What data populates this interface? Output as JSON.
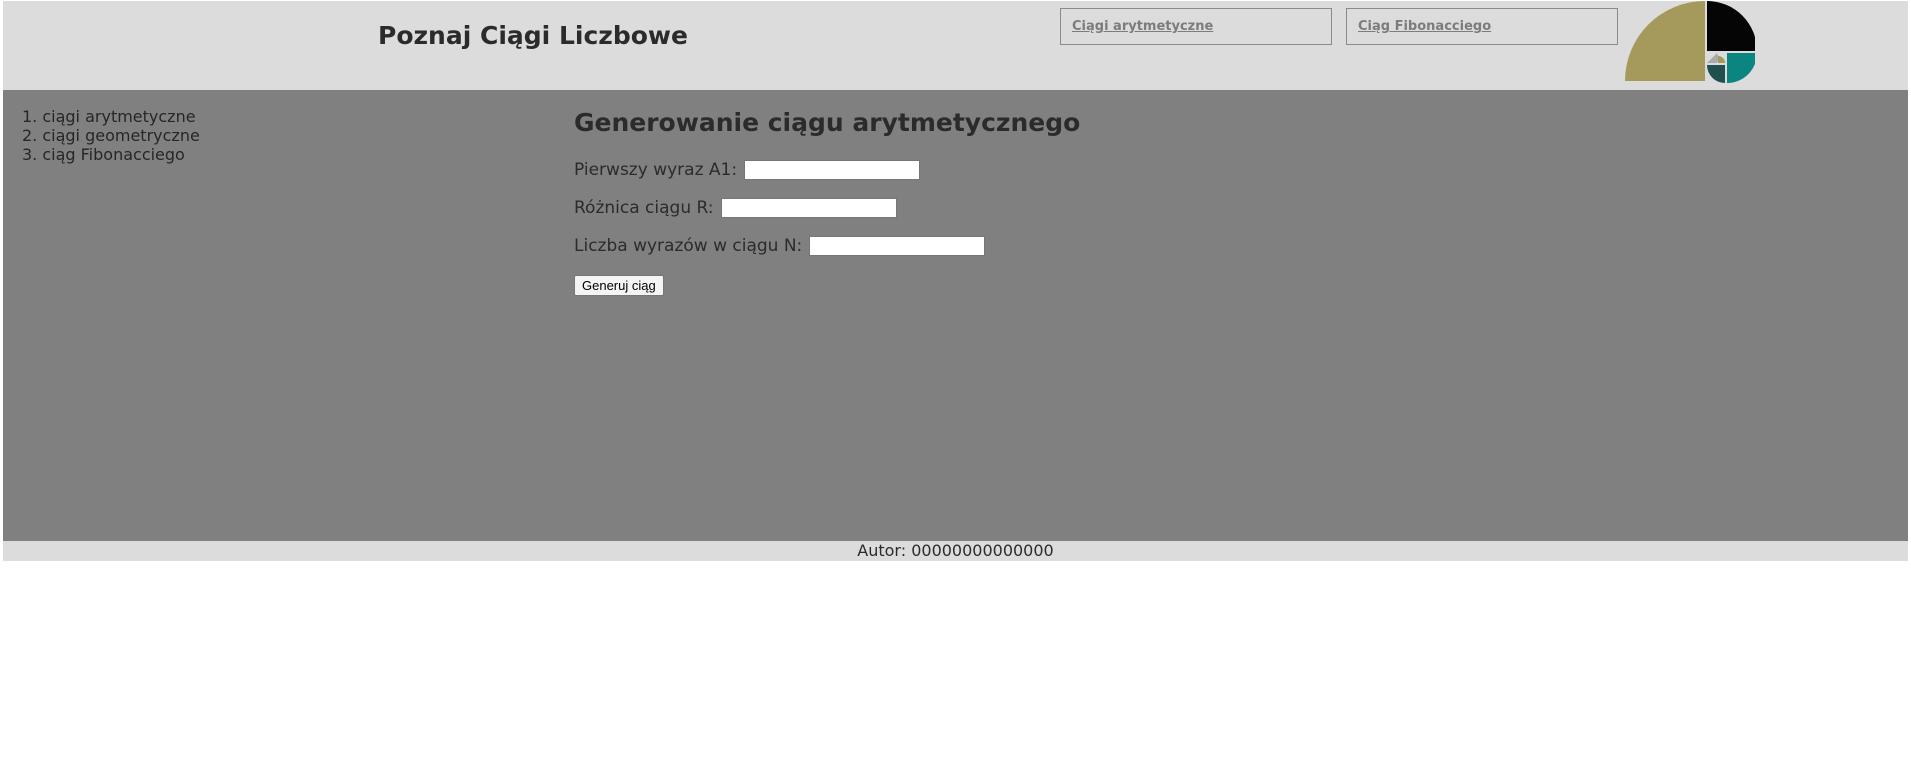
{
  "header": {
    "title": "Poznaj Ciągi Liczbowe",
    "nav": [
      {
        "label": "Ciągi arytmetyczne"
      },
      {
        "label": "Ciąg Fibonacciego"
      }
    ],
    "logo": {
      "icon": "fibonacci-spiral-logo",
      "colors": [
        "#a59a5b",
        "#050505",
        "#0b8580",
        "#1f4f4e",
        "#a9a9a9"
      ]
    }
  },
  "sidebar": {
    "items": [
      {
        "label": "1. ciągi arytmetyczne"
      },
      {
        "label": "2. ciągi geometryczne"
      },
      {
        "label": "3. ciąg Fibonacciego"
      }
    ]
  },
  "main": {
    "heading": "Generowanie ciągu arytmetycznego",
    "fields": [
      {
        "label": "Pierwszy wyraz A1:",
        "value": ""
      },
      {
        "label": "Różnica ciągu R:",
        "value": ""
      },
      {
        "label": "Liczba wyrazów w ciągu N:",
        "value": ""
      }
    ],
    "button_label": "Generuj ciąg"
  },
  "footer": {
    "text": "Autor: 00000000000000"
  },
  "colors": {
    "header_bg": "#dcdcdc",
    "content_bg": "#808080",
    "text": "#2b2b2b",
    "link": "#7c7c7c"
  }
}
